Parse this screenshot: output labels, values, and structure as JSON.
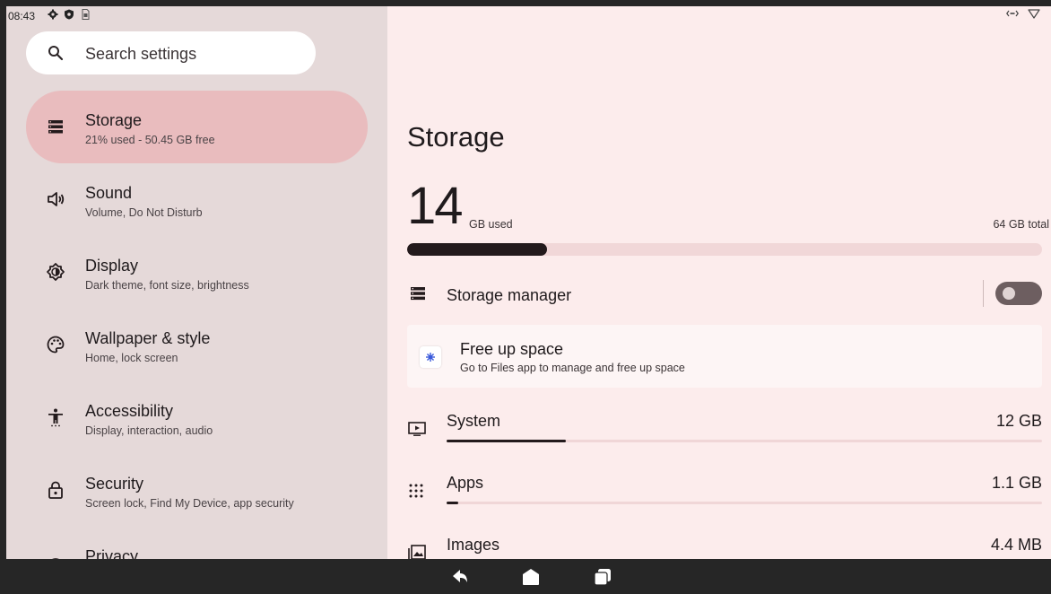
{
  "status_bar": {
    "time": "08:43",
    "left_icons": [
      "gear-icon",
      "shield-icon",
      "sim-icon"
    ],
    "right_icons": [
      "vibrate-icon",
      "wifi-icon"
    ]
  },
  "search": {
    "placeholder": "Search settings",
    "icon": "search-icon"
  },
  "sidebar": {
    "items": [
      {
        "title": "Storage",
        "subtitle": "21% used - 50.45 GB free",
        "icon": "storage-icon",
        "active": true
      },
      {
        "title": "Sound",
        "subtitle": "Volume, Do Not Disturb",
        "icon": "volume-icon"
      },
      {
        "title": "Display",
        "subtitle": "Dark theme, font size, brightness",
        "icon": "brightness-icon"
      },
      {
        "title": "Wallpaper & style",
        "subtitle": "Home, lock screen",
        "icon": "palette-icon"
      },
      {
        "title": "Accessibility",
        "subtitle": "Display, interaction, audio",
        "icon": "accessibility-icon"
      },
      {
        "title": "Security",
        "subtitle": "Screen lock, Find My Device, app security",
        "icon": "lock-icon"
      },
      {
        "title": "Privacy",
        "subtitle": "",
        "icon": "privacy-icon"
      }
    ]
  },
  "main": {
    "title": "Storage",
    "used_value": "14",
    "used_unit": "GB used",
    "total": "64 GB total",
    "used_fraction": 0.22,
    "storage_manager": {
      "label": "Storage manager",
      "enabled": false
    },
    "free_up": {
      "title": "Free up space",
      "subtitle": "Go to Files app to manage and free up space"
    },
    "categories": [
      {
        "label": "System",
        "value": "12 GB",
        "fraction": 0.2,
        "icon": "system-icon"
      },
      {
        "label": "Apps",
        "value": "1.1 GB",
        "fraction": 0.02,
        "icon": "apps-grid-icon"
      },
      {
        "label": "Images",
        "value": "4.4 MB",
        "fraction": 0.0,
        "icon": "image-icon"
      }
    ]
  },
  "nav_bar": {
    "buttons": [
      "back-icon",
      "home-icon",
      "recents-icon"
    ]
  },
  "colors": {
    "accent": "#e9bcbe",
    "sidebar_bg": "#e5d9d9",
    "content_bg": "#fcecec",
    "bar": "#231a1c"
  }
}
